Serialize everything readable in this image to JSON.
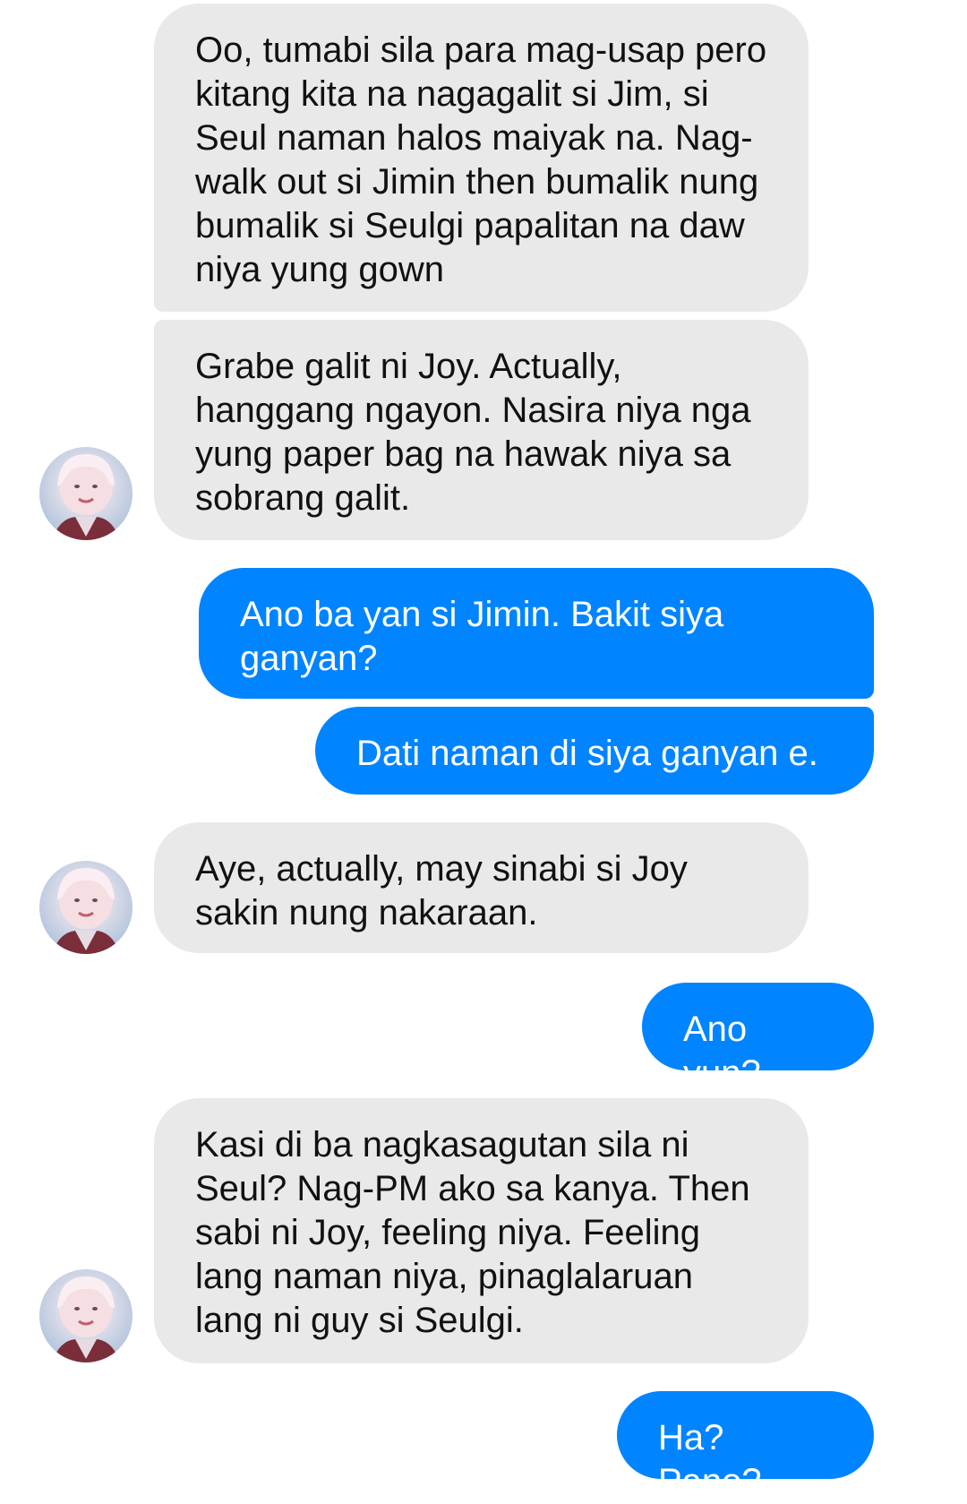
{
  "colors": {
    "incoming_bubble": "#e9e9ea",
    "outgoing_bubble": "#0084ff",
    "incoming_text": "#111111",
    "outgoing_text": "#ffffff"
  },
  "contact": {
    "avatar_icon": "profile-photo-avatar"
  },
  "messages": [
    {
      "sender": "them",
      "text": "Oo, tumabi sila para mag-usap pero kitang kita na nagagalit si Jim, si Seul naman halos maiyak na. Nag-walk out si Jimin then bumalik nung bumalik si Seulgi papalitan na daw niya yung gown"
    },
    {
      "sender": "them",
      "text": "Grabe galit ni Joy. Actually, hanggang ngayon. Nasira niya nga yung paper bag na hawak niya sa sobrang galit."
    },
    {
      "sender": "me",
      "text": "Ano ba yan si Jimin. Bakit siya ganyan?"
    },
    {
      "sender": "me",
      "text": "Dati naman di siya ganyan e."
    },
    {
      "sender": "them",
      "text": "Aye, actually, may sinabi si Joy sakin nung nakaraan."
    },
    {
      "sender": "me",
      "text": "Ano yun?"
    },
    {
      "sender": "them",
      "text": "Kasi di ba nagkasagutan sila ni Seul? Nag-PM ako sa kanya. Then sabi ni Joy, feeling niya. Feeling lang naman niya, pinaglalaruan lang ni guy si Seulgi."
    },
    {
      "sender": "me",
      "text": "Ha? Pano?"
    }
  ]
}
